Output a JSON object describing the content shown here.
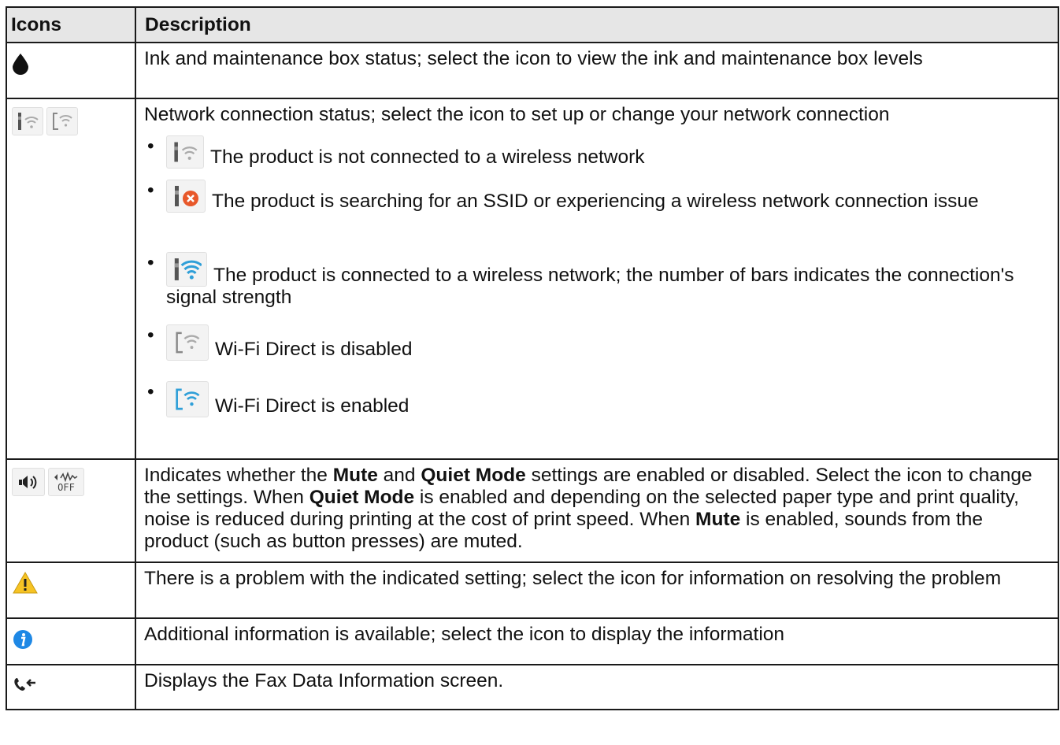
{
  "headers": {
    "icons": "Icons",
    "description": "Description"
  },
  "rows": {
    "ink": {
      "icon": "ink-drop-icon",
      "text": "Ink and maintenance box status; select the icon to view the ink and maintenance box levels"
    },
    "network": {
      "icons": [
        "wireless-not-connected-icon",
        "wifi-direct-icon"
      ],
      "text": "Network connection status; select the icon to set up or change your network connection",
      "items": [
        {
          "icon": "wireless-not-connected-icon",
          "text": "The product is not connected to a wireless network"
        },
        {
          "icon": "wireless-error-icon",
          "text": "The product is searching for an SSID or experiencing a wireless network connection issue"
        },
        {
          "icon": "wireless-connected-icon",
          "text": "The product is connected to a wireless network; the number of bars indicates the connection's signal strength"
        },
        {
          "icon": "wifi-direct-disabled-icon",
          "text": "Wi-Fi Direct is disabled"
        },
        {
          "icon": "wifi-direct-enabled-icon",
          "text": "Wi-Fi Direct is enabled"
        }
      ]
    },
    "mute": {
      "icons": [
        "speaker-icon",
        "quiet-mode-off-icon"
      ],
      "quiet_off_label": "OFF",
      "s1": "Indicates whether the ",
      "b1": "Mute",
      "s2": " and ",
      "b2": "Quiet Mode",
      "s3": " settings are enabled or disabled. Select the icon to change the settings. When ",
      "b3": "Quiet Mode",
      "s4": " is enabled and depending on the selected paper type and print quality, noise is reduced during printing at the cost of print speed. When ",
      "b4": "Mute",
      "s5": " is enabled, sounds from the product (such as button presses) are muted."
    },
    "warning": {
      "icon": "warning-icon",
      "text": "There is a problem with the indicated setting; select the icon for information on resolving the problem"
    },
    "info": {
      "icon": "info-icon",
      "text": "Additional information is available; select the icon to display the information"
    },
    "fax": {
      "icon": "fax-data-icon",
      "text": "Displays the Fax Data Information screen."
    }
  },
  "colors": {
    "header_bg": "#e6e6e6",
    "wifi_blue": "#2f9fd8",
    "error_orange": "#e8582a",
    "info_blue": "#1e88e5",
    "warning_yellow": "#f6c324"
  }
}
